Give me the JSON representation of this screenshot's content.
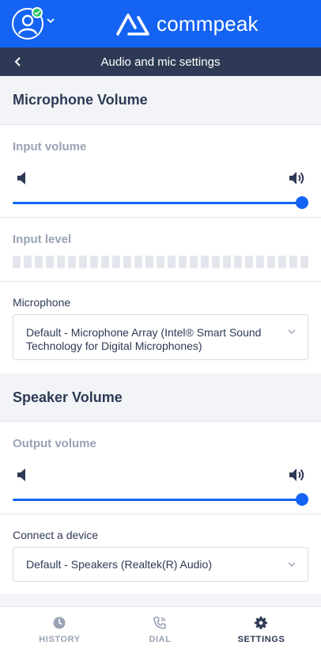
{
  "app": {
    "brand": "commpeak",
    "status_color": "#22c55e",
    "accent": "#1463f3"
  },
  "header": {
    "title": "Audio and mic settings",
    "back_icon": "chevron-left-icon"
  },
  "microphone_section": {
    "title": "Microphone Volume",
    "input_volume_label": "Input volume",
    "input_volume_level": 1.0,
    "input_level_label": "Input level",
    "input_level_active_segments": 0,
    "microphone_label": "Microphone",
    "microphone_value": "Default - Microphone Array (Intel® Smart Sound Technology for Digital Microphones)"
  },
  "speaker_section": {
    "title": "Speaker Volume",
    "output_volume_label": "Output volume",
    "output_volume_level": 1.0,
    "device_label": "Connect a device",
    "device_value": "Default - Speakers (Realtek(R) Audio)"
  },
  "nav": {
    "items": [
      {
        "label": "HISTORY",
        "icon": "clock-icon",
        "active": false
      },
      {
        "label": "DIAL",
        "icon": "phone-icon",
        "active": false
      },
      {
        "label": "SETTINGS",
        "icon": "gear-icon",
        "active": true
      }
    ]
  }
}
